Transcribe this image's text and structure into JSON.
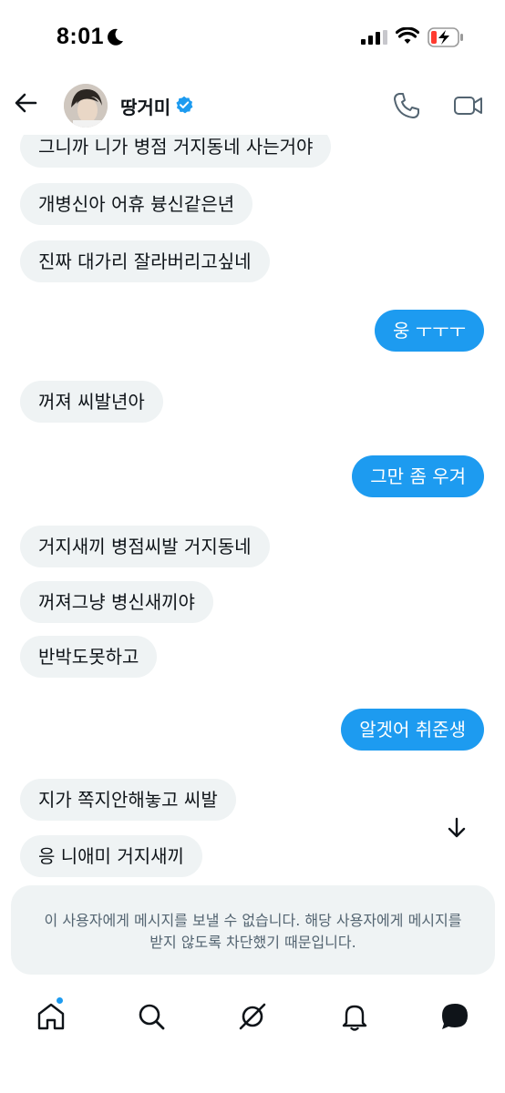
{
  "status_bar": {
    "time": "8:01"
  },
  "header": {
    "username": "땅거미",
    "icons": [
      "back-arrow-icon",
      "verified-badge-icon",
      "phone-icon",
      "video-icon"
    ]
  },
  "messages": [
    {
      "side": "in",
      "text": "그니까 니가 병점 거지동네 사는거야"
    },
    {
      "side": "in",
      "text": "개병신아 어휴 븅신같은년"
    },
    {
      "side": "in",
      "text": "진짜 대가리 잘라버리고싶네"
    },
    {
      "side": "out",
      "text": "웅 ㅜㅜㅜ"
    },
    {
      "side": "in",
      "text": "꺼져 씨발년아"
    },
    {
      "side": "out",
      "text": "그만 좀 우겨"
    },
    {
      "side": "in",
      "text": "거지새끼 병점씨발 거지동네"
    },
    {
      "side": "in",
      "text": "꺼져그냥 병신새끼야"
    },
    {
      "side": "in",
      "text": "반박도못하고"
    },
    {
      "side": "out",
      "text": "알겟어 취준생"
    },
    {
      "side": "in",
      "text": "지가 쪽지안해놓고 씨발"
    },
    {
      "side": "in",
      "text": "응 니애미 거지새끼"
    }
  ],
  "notice": {
    "line1": "이 사용자에게 메시지를 보낼 수 없습니다. 해당 사용자에게 메시지를",
    "line2": "받지 않도록 차단했기 때문입니다."
  },
  "tabbar": {
    "items": [
      "home-icon",
      "search-icon",
      "grok-icon",
      "notifications-icon",
      "messages-icon"
    ],
    "home_has_badge": true
  },
  "colors": {
    "accent": "#1d9bf0",
    "incoming_bubble": "#eff3f4",
    "text": "#0f1419",
    "muted": "#536471"
  }
}
